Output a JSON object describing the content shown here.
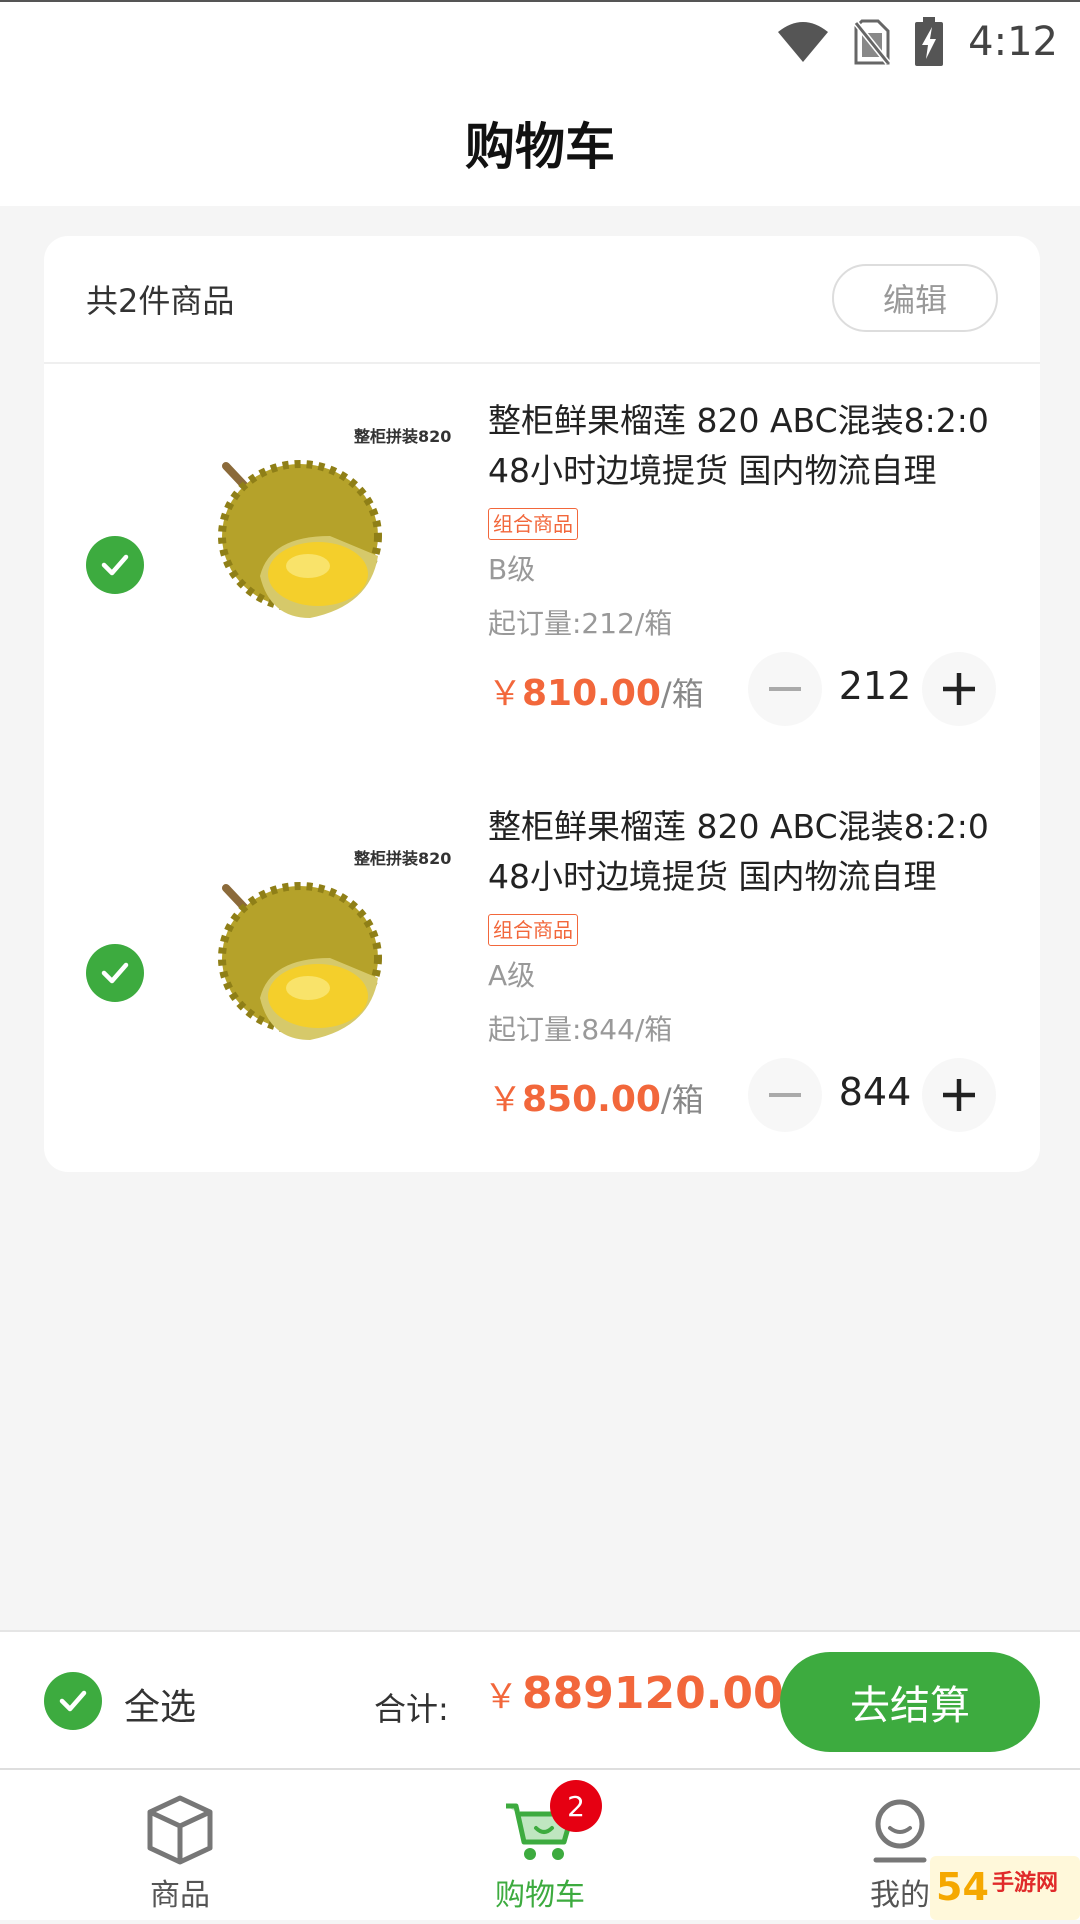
{
  "status_bar": {
    "time": "4:12",
    "icons": [
      "wifi-icon",
      "no-sim-icon",
      "battery-charging-icon"
    ]
  },
  "header": {
    "title": "购物车"
  },
  "cart": {
    "summary": "共2件商品",
    "edit_label": "编辑",
    "items": [
      {
        "title": "整柜鲜果榴莲 820 ABC混装8:2:0 48小时边境提货 国内物流自理",
        "image_caption": "整柜拼装820",
        "tag": "组合商品",
        "grade": "B级",
        "moq": "起订量:212/箱",
        "currency": "￥",
        "price": "810.00",
        "unit": "/箱",
        "quantity": "212",
        "selected": true
      },
      {
        "title": "整柜鲜果榴莲 820 ABC混装8:2:0 48小时边境提货 国内物流自理",
        "image_caption": "整柜拼装820",
        "tag": "组合商品",
        "grade": "A级",
        "moq": "起订量:844/箱",
        "currency": "￥",
        "price": "850.00",
        "unit": "/箱",
        "quantity": "844",
        "selected": true
      }
    ]
  },
  "checkout": {
    "select_all_label": "全选",
    "total_label": "合计:",
    "currency": "￥",
    "total_amount": "889120.00",
    "checkout_label": "去结算"
  },
  "tabs": [
    {
      "label": "商品",
      "icon": "box-icon",
      "active": false
    },
    {
      "label": "购物车",
      "icon": "cart-icon",
      "active": true,
      "badge": "2"
    },
    {
      "label": "我的",
      "icon": "profile-icon",
      "active": false
    }
  ],
  "watermark": {
    "text": "54手游网"
  },
  "colors": {
    "accent": "#3dab3f",
    "price": "#f2673b",
    "badge": "#e60012"
  }
}
